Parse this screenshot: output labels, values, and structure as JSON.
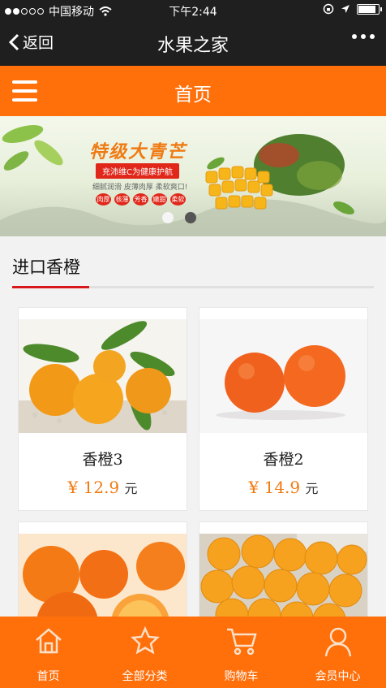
{
  "status_bar": {
    "carrier": "中国移动",
    "time": "下午2:44",
    "battery_level": 0.9
  },
  "nav": {
    "back_label": "返回",
    "title": "水果之家"
  },
  "header": {
    "title": "首页"
  },
  "banner": {
    "title": "特级大青芒",
    "subtitle": "充沛维C为健康护航",
    "small_text": "细腻润滑  皮薄肉厚  柔软爽口!",
    "tags": [
      "肉厚",
      "核薄",
      "芳香",
      "嫩甜",
      "柔软"
    ],
    "active_page": 1,
    "page_count": 2
  },
  "section": {
    "title": "进口香橙"
  },
  "products": [
    {
      "name": "香橙3",
      "currency": "¥",
      "price": "12.9",
      "unit": "元"
    },
    {
      "name": "香橙2",
      "currency": "¥",
      "price": "14.9",
      "unit": "元"
    }
  ],
  "tabbar": {
    "items": [
      {
        "label": "首页",
        "icon": "home-icon"
      },
      {
        "label": "全部分类",
        "icon": "star-icon"
      },
      {
        "label": "购物车",
        "icon": "cart-icon"
      },
      {
        "label": "会员中心",
        "icon": "user-icon"
      }
    ]
  },
  "colors": {
    "accent": "#ff6f0a",
    "price": "#f07a12",
    "underline": "#d7191d",
    "bar": "#1f1f1f"
  }
}
